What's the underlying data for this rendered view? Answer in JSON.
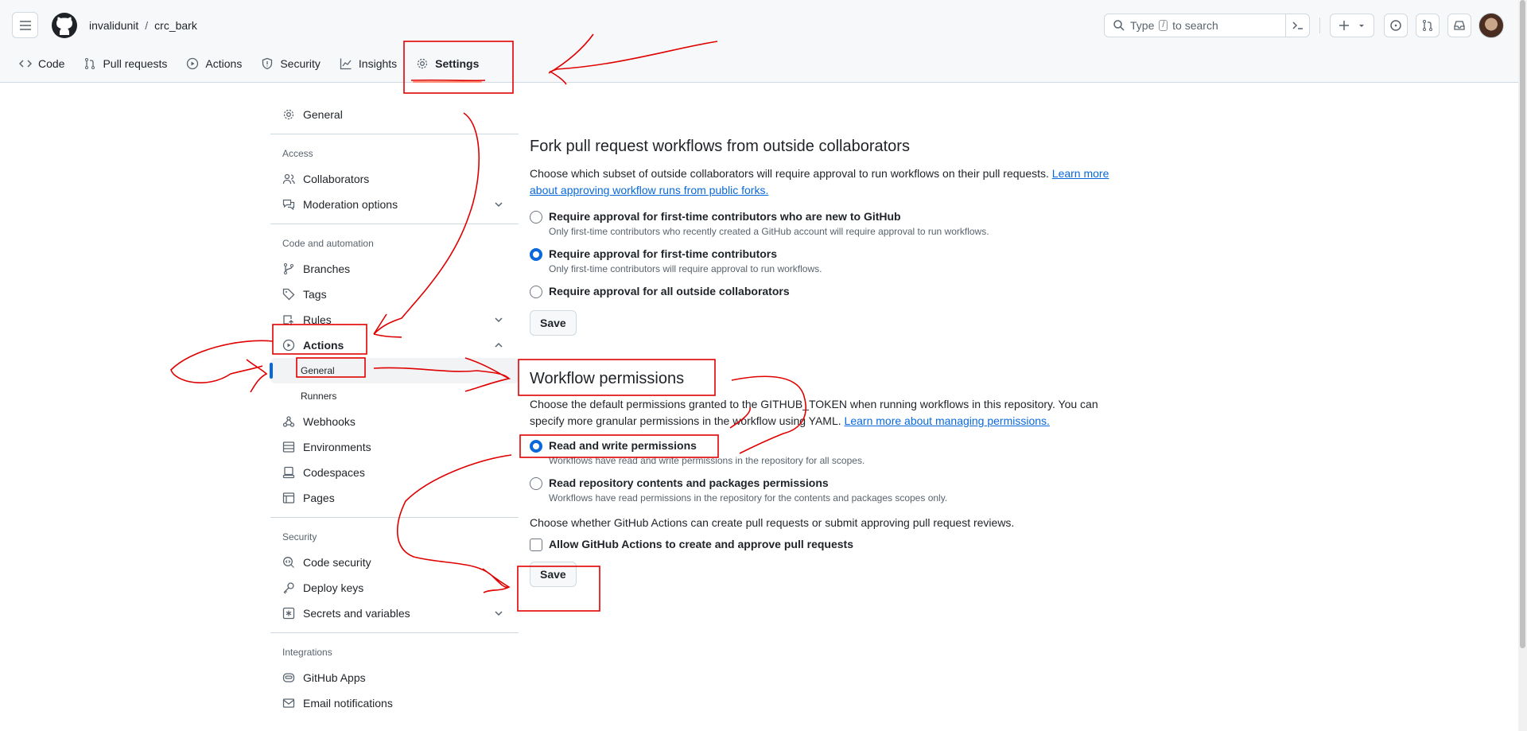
{
  "header": {
    "owner": "invalidunit",
    "separator": "/",
    "repo": "crc_bark",
    "search_prefix": "Type",
    "search_key": "/",
    "search_suffix": "to search"
  },
  "tabs": [
    {
      "label": "Code",
      "icon": "code-icon"
    },
    {
      "label": "Pull requests",
      "icon": "pull-request-icon"
    },
    {
      "label": "Actions",
      "icon": "play-icon"
    },
    {
      "label": "Security",
      "icon": "shield-icon"
    },
    {
      "label": "Insights",
      "icon": "graph-icon"
    },
    {
      "label": "Settings",
      "icon": "gear-icon",
      "active": true
    }
  ],
  "sidebar": {
    "general": "General",
    "access_heading": "Access",
    "collaborators": "Collaborators",
    "moderation": "Moderation options",
    "code_heading": "Code and automation",
    "branches": "Branches",
    "tags": "Tags",
    "rules": "Rules",
    "actions": "Actions",
    "actions_general": "General",
    "runners": "Runners",
    "webhooks": "Webhooks",
    "environments": "Environments",
    "codespaces": "Codespaces",
    "pages": "Pages",
    "security_heading": "Security",
    "code_security": "Code security",
    "deploy_keys": "Deploy keys",
    "secrets": "Secrets and variables",
    "integrations_heading": "Integrations",
    "github_apps": "GitHub Apps",
    "email_notifications": "Email notifications"
  },
  "fork": {
    "title": "Fork pull request workflows from outside collaborators",
    "desc": "Choose which subset of outside collaborators will require approval to run workflows on their pull requests.",
    "learn_more": "Learn more about approving workflow runs from public forks.",
    "options": [
      {
        "label": "Require approval for first-time contributors who are new to GitHub",
        "note": "Only first-time contributors who recently created a GitHub account will require approval to run workflows.",
        "checked": false
      },
      {
        "label": "Require approval for first-time contributors",
        "note": "Only first-time contributors will require approval to run workflows.",
        "checked": true
      },
      {
        "label": "Require approval for all outside collaborators",
        "note": "",
        "checked": false
      }
    ],
    "save": "Save"
  },
  "workflow": {
    "title": "Workflow permissions",
    "desc": "Choose the default permissions granted to the GITHUB_TOKEN when running workflows in this repository. You can specify more granular permissions in the workflow using YAML.",
    "learn_more": "Learn more about managing permissions.",
    "options": [
      {
        "label": "Read and write permissions",
        "note": "Workflows have read and write permissions in the repository for all scopes.",
        "checked": true
      },
      {
        "label": "Read repository contents and packages permissions",
        "note": "Workflows have read permissions in the repository for the contents and packages scopes only.",
        "checked": false
      }
    ],
    "pr_desc": "Choose whether GitHub Actions can create pull requests or submit approving pull request reviews.",
    "pr_checkbox": "Allow GitHub Actions to create and approve pull requests",
    "pr_checked": false,
    "save": "Save"
  },
  "colors": {
    "annotation": "#e00000",
    "accent": "#0969da",
    "tab_underline": "#fd8c73"
  }
}
